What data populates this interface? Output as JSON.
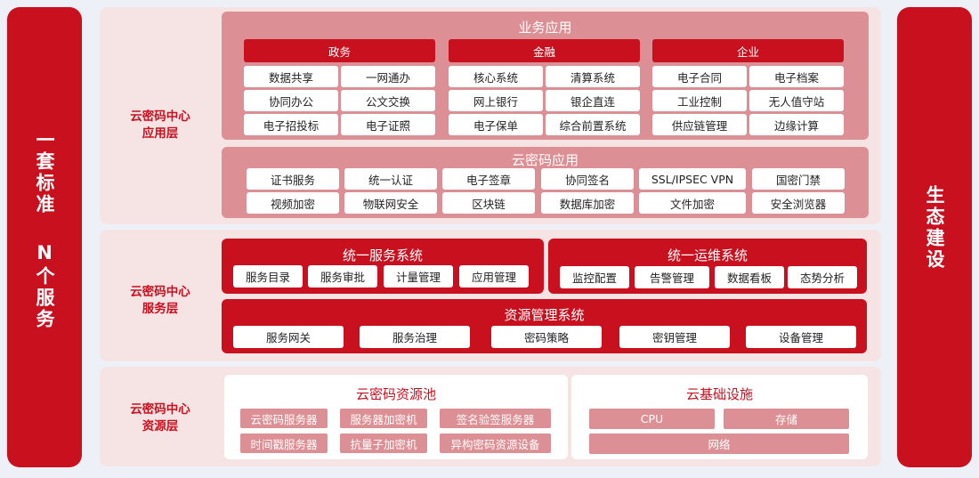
{
  "left_bar": {
    "line1": "一套标准",
    "line2": "N个服务"
  },
  "right_bar": {
    "text": "生态建设"
  },
  "app_layer": {
    "label_line1": "云密码中心",
    "label_line2": "应用层",
    "business": {
      "title": "业务应用",
      "categories": [
        {
          "name": "政务",
          "items": [
            "数据共享",
            "一网通办",
            "协同办公",
            "公文交换",
            "电子招投标",
            "电子证照"
          ]
        },
        {
          "name": "金融",
          "items": [
            "核心系统",
            "清算系统",
            "网上银行",
            "银企直连",
            "电子保单",
            "综合前置系统"
          ]
        },
        {
          "name": "企业",
          "items": [
            "电子合同",
            "电子档案",
            "工业控制",
            "无人值守站",
            "供应链管理",
            "边缘计算"
          ]
        }
      ]
    },
    "cloud_crypto": {
      "title": "云密码应用",
      "items": [
        "证书服务",
        "统一认证",
        "电子签章",
        "协同签名",
        "SSL/IPSEC VPN",
        "国密门禁",
        "视频加密",
        "物联网安全",
        "区块链",
        "数据库加密",
        "文件加密",
        "安全浏览器"
      ]
    }
  },
  "service_layer": {
    "label_line1": "云密码中心",
    "label_line2": "服务层",
    "unified_service": {
      "title": "统一服务系统",
      "items": [
        "服务目录",
        "服务审批",
        "计量管理",
        "应用管理"
      ]
    },
    "unified_ops": {
      "title": "统一运维系统",
      "items": [
        "监控配置",
        "告警管理",
        "数据看板",
        "态势分析"
      ]
    },
    "resource_mgmt": {
      "title": "资源管理系统",
      "items": [
        "服务网关",
        "服务治理",
        "密码策略",
        "密钥管理",
        "设备管理"
      ]
    }
  },
  "resource_layer": {
    "label_line1": "云密码中心",
    "label_line2": "资源层",
    "pool": {
      "title": "云密码资源池",
      "items": [
        "云密码服务器",
        "服务器加密机",
        "签名验签服务器",
        "时间戳服务器",
        "抗量子加密机",
        "异构密码资源设备"
      ]
    },
    "infra": {
      "title": "云基础设施",
      "items": [
        "CPU",
        "存储",
        "网络"
      ]
    }
  }
}
